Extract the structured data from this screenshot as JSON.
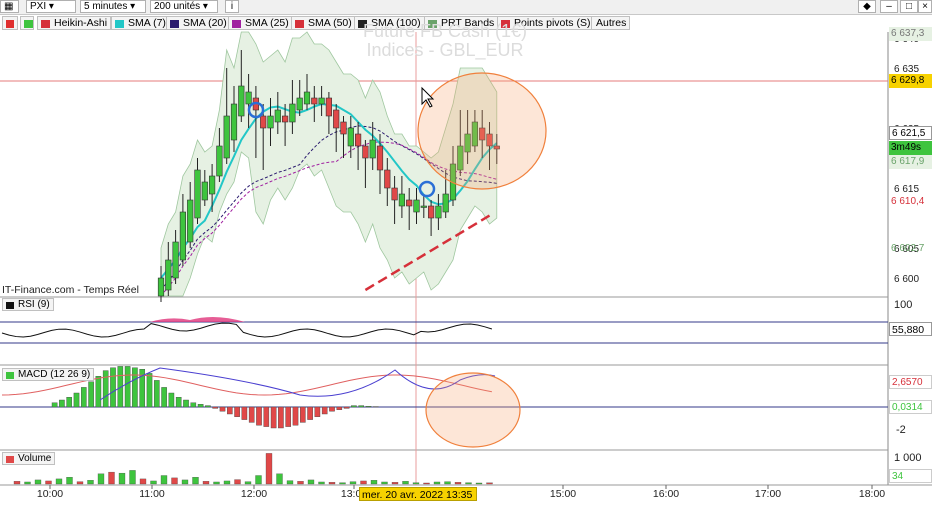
{
  "toolbar": {
    "symbol": "PXI",
    "timeframe": "5 minutes",
    "units": "200 unités",
    "info_icon": "info-icon"
  },
  "legend": [
    {
      "label": "Heikin-Ashi",
      "color": "#d6303a"
    },
    {
      "label": "SMA (7)",
      "color": "#22c7c7"
    },
    {
      "label": "SMA (20)",
      "color": "#2a1a6e"
    },
    {
      "label": "SMA (25)",
      "color": "#a020a0"
    },
    {
      "label": "SMA (50)",
      "color": "#d6303a"
    },
    {
      "label": "SMA (100)",
      "color": "#222222"
    },
    {
      "label": "PRT Bands",
      "color": "#6aa36a"
    },
    {
      "label": "Points pivots (S)",
      "color": "#d6303a"
    },
    {
      "label": "Autres",
      "color": ""
    }
  ],
  "watermark": {
    "line1": "Future FB Cash (1€)",
    "line2": "Indices - GBL_EUR"
  },
  "source_label": "IT-Finance.com - Temps Réel",
  "cursor_date": "mer. 20 avr. 2022 13:35",
  "price_chips": {
    "top": "6 637,3",
    "red_line": "6 629,8",
    "current": "6 621,5",
    "countdown": "3m49s",
    "green1": "6 617,9",
    "red2": "6 610,4",
    "green2": "6 602,7"
  },
  "rsi": {
    "label": "RSI (9)",
    "top": "100",
    "value": "55,880"
  },
  "macd": {
    "label": "MACD (12 26 9)",
    "v1": "2,6570",
    "v2": "0,0314",
    "low": "-2"
  },
  "volume": {
    "label": "Volume",
    "top": "1 000",
    "value": "34"
  },
  "colors": {
    "up": "#3ec43e",
    "down": "#e04848",
    "sma7": "#22c7c7",
    "band": "#e6f1e3",
    "circle": "#f7a670"
  },
  "chart_data": {
    "type": "candlestick",
    "title": "",
    "x_ticks": [
      "10:00",
      "11:00",
      "12:00",
      "13:00",
      "15:00",
      "16:00",
      "17:00",
      "18:00"
    ],
    "y_ticks": [
      6600,
      6605,
      6615,
      6625,
      6635,
      6640
    ],
    "ylim": [
      6597,
      6641
    ],
    "candles": [
      {
        "o": 6597,
        "c": 6600,
        "h": 6602,
        "l": 6596
      },
      {
        "o": 6598,
        "c": 6603,
        "h": 6606,
        "l": 6597
      },
      {
        "o": 6600,
        "c": 6606,
        "h": 6608,
        "l": 6599
      },
      {
        "o": 6603,
        "c": 6611,
        "h": 6614,
        "l": 6602
      },
      {
        "o": 6606,
        "c": 6613,
        "h": 6616,
        "l": 6605
      },
      {
        "o": 6610,
        "c": 6618,
        "h": 6620,
        "l": 6609
      },
      {
        "o": 6613,
        "c": 6616,
        "h": 6618,
        "l": 6612
      },
      {
        "o": 6614,
        "c": 6617,
        "h": 6619,
        "l": 6611
      },
      {
        "o": 6617,
        "c": 6622,
        "h": 6625,
        "l": 6616
      },
      {
        "o": 6620,
        "c": 6627,
        "h": 6635,
        "l": 6619
      },
      {
        "o": 6623,
        "c": 6629,
        "h": 6632,
        "l": 6621
      },
      {
        "o": 6627,
        "c": 6632,
        "h": 6638,
        "l": 6626
      },
      {
        "o": 6629,
        "c": 6631,
        "h": 6634,
        "l": 6625
      },
      {
        "o": 6630,
        "c": 6628,
        "h": 6632,
        "l": 6620
      },
      {
        "o": 6627,
        "c": 6625,
        "h": 6629,
        "l": 6618
      },
      {
        "o": 6625,
        "c": 6627,
        "h": 6630,
        "l": 6622
      },
      {
        "o": 6626,
        "c": 6628,
        "h": 6631,
        "l": 6624
      },
      {
        "o": 6627,
        "c": 6626,
        "h": 6629,
        "l": 6622
      },
      {
        "o": 6626,
        "c": 6629,
        "h": 6633,
        "l": 6624
      },
      {
        "o": 6628,
        "c": 6630,
        "h": 6633,
        "l": 6627
      },
      {
        "o": 6629,
        "c": 6631,
        "h": 6634,
        "l": 6628
      },
      {
        "o": 6630,
        "c": 6629,
        "h": 6632,
        "l": 6626
      },
      {
        "o": 6629,
        "c": 6630,
        "h": 6632,
        "l": 6627
      },
      {
        "o": 6630,
        "c": 6627,
        "h": 6631,
        "l": 6624
      },
      {
        "o": 6628,
        "c": 6625,
        "h": 6629,
        "l": 6621
      },
      {
        "o": 6626,
        "c": 6624,
        "h": 6627,
        "l": 6620
      },
      {
        "o": 6622,
        "c": 6625,
        "h": 6627,
        "l": 6620
      },
      {
        "o": 6624,
        "c": 6622,
        "h": 6626,
        "l": 6618
      },
      {
        "o": 6622,
        "c": 6620,
        "h": 6623,
        "l": 6615
      },
      {
        "o": 6620,
        "c": 6623,
        "h": 6626,
        "l": 6618
      },
      {
        "o": 6622,
        "c": 6618,
        "h": 6624,
        "l": 6614
      },
      {
        "o": 6618,
        "c": 6615,
        "h": 6620,
        "l": 6612
      },
      {
        "o": 6615,
        "c": 6613,
        "h": 6617,
        "l": 6609
      },
      {
        "o": 6612,
        "c": 6614,
        "h": 6617,
        "l": 6610
      },
      {
        "o": 6613,
        "c": 6612,
        "h": 6615,
        "l": 6608
      },
      {
        "o": 6611,
        "c": 6613,
        "h": 6615,
        "l": 6609
      },
      {
        "o": 6612,
        "c": 6612,
        "h": 6614,
        "l": 6610
      },
      {
        "o": 6612,
        "c": 6610,
        "h": 6613,
        "l": 6607
      },
      {
        "o": 6610,
        "c": 6612,
        "h": 6614,
        "l": 6608
      },
      {
        "o": 6611,
        "c": 6614,
        "h": 6618,
        "l": 6610
      },
      {
        "o": 6613,
        "c": 6619,
        "h": 6622,
        "l": 6612
      },
      {
        "o": 6618,
        "c": 6622,
        "h": 6628,
        "l": 6617
      },
      {
        "o": 6621,
        "c": 6624,
        "h": 6628,
        "l": 6619
      },
      {
        "o": 6622,
        "c": 6626,
        "h": 6628,
        "l": 6621
      },
      {
        "o": 6625,
        "c": 6623,
        "h": 6628,
        "l": 6620
      },
      {
        "o": 6624,
        "c": 6622,
        "h": 6626,
        "l": 6618
      },
      {
        "o": 6622,
        "c": 6621.5,
        "h": 6624,
        "l": 6619
      }
    ],
    "volume": [
      80,
      60,
      120,
      90,
      150,
      200,
      70,
      110,
      300,
      350,
      320,
      400,
      150,
      90,
      250,
      180,
      120,
      200,
      80,
      60,
      90,
      130,
      70,
      250,
      900,
      300,
      100,
      80,
      120,
      60,
      50,
      40,
      70,
      90,
      110,
      60,
      50,
      80,
      40,
      30,
      60,
      70,
      50,
      40,
      30,
      34
    ],
    "macd_hist": [
      0.3,
      0.5,
      0.7,
      1.0,
      1.4,
      1.8,
      2.2,
      2.6,
      2.8,
      2.9,
      2.9,
      2.8,
      2.7,
      2.4,
      1.9,
      1.4,
      1.0,
      0.7,
      0.5,
      0.3,
      0.2,
      0.1,
      -0.1,
      -0.3,
      -0.5,
      -0.7,
      -0.9,
      -1.1,
      -1.3,
      -1.4,
      -1.5,
      -1.5,
      -1.4,
      -1.3,
      -1.1,
      -0.9,
      -0.7,
      -0.5,
      -0.3,
      -0.2,
      -0.1,
      0.1,
      0.1,
      0.05,
      0.03
    ]
  }
}
